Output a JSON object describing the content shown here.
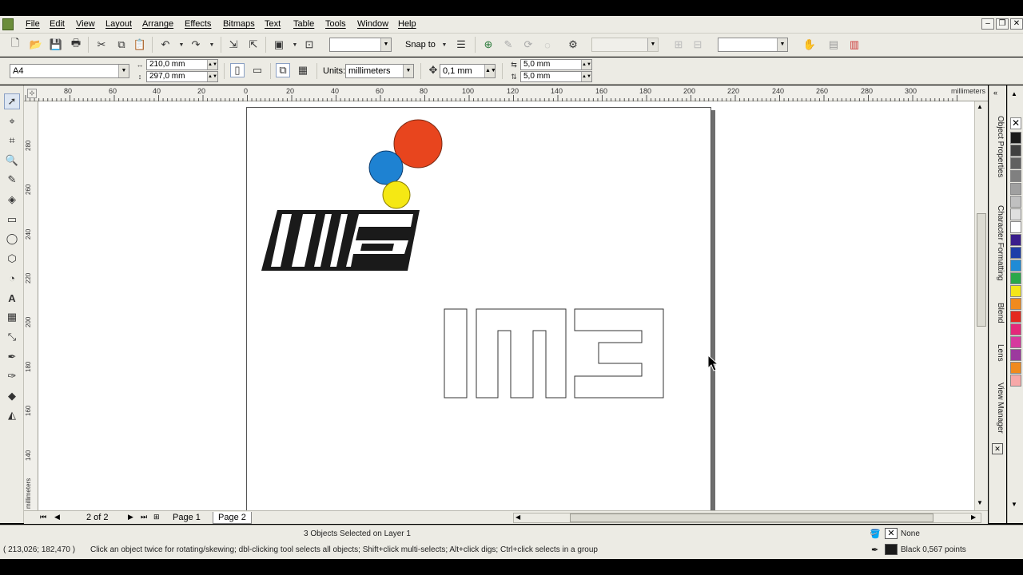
{
  "menu": [
    "File",
    "Edit",
    "View",
    "Layout",
    "Arrange",
    "Effects",
    "Bitmaps",
    "Text",
    "Table",
    "Tools",
    "Window",
    "Help"
  ],
  "toolbar": {
    "snap_to": "Snap to",
    "zoom_value": "",
    "font_value": ""
  },
  "property_bar": {
    "paper": "A4",
    "width": "210,0 mm",
    "height": "297,0 mm",
    "units_label": "Units:",
    "units_value": "millimeters",
    "nudge": "0,1 mm",
    "dup_x": "5,0 mm",
    "dup_y": "5,0 mm"
  },
  "ruler": {
    "top_ticks": [
      "80",
      "60",
      "40",
      "20",
      "0",
      "20",
      "40",
      "60",
      "80",
      "100",
      "120",
      "140",
      "160",
      "180",
      "200",
      "220",
      "240",
      "260",
      "280",
      "300"
    ],
    "top_units": "millimeters",
    "left_ticks": [
      "280",
      "260",
      "240",
      "220",
      "200",
      "180",
      "160",
      "140"
    ],
    "left_units": "millimeters"
  },
  "docker_tabs": [
    "Object Properties",
    "Character Formatting",
    "Blend",
    "Lens",
    "View Manager"
  ],
  "palette_colors": [
    "#1a1a1a",
    "#404040",
    "#606060",
    "#808080",
    "#a0a0a0",
    "#c0c0c0",
    "#e0e0e0",
    "#ffffff",
    "#3a1e8c",
    "#1e3ea8",
    "#1f8bd6",
    "#2aa84a",
    "#f5e618",
    "#f08a1e",
    "#e4281f",
    "#e4287a",
    "#d63a9e",
    "#9c3a9e",
    "#f08a1e",
    "#f7a8a8"
  ],
  "pages": {
    "counter": "2 of 2",
    "tabs": [
      "Page 1",
      "Page 2"
    ],
    "active": "Page 2"
  },
  "status": {
    "selection": "3 Objects Selected on Layer 1",
    "coords": "( 213,026; 182,470 )",
    "hint": "Click an object twice for rotating/skewing; dbl-clicking tool selects all objects; Shift+click multi-selects; Alt+click digs; Ctrl+click selects in a group",
    "fill": "None",
    "outline": "Black  0,567 points"
  },
  "logo": {
    "circle_colors": [
      "#e8451e",
      "#1e82d2",
      "#f5e814"
    ]
  }
}
